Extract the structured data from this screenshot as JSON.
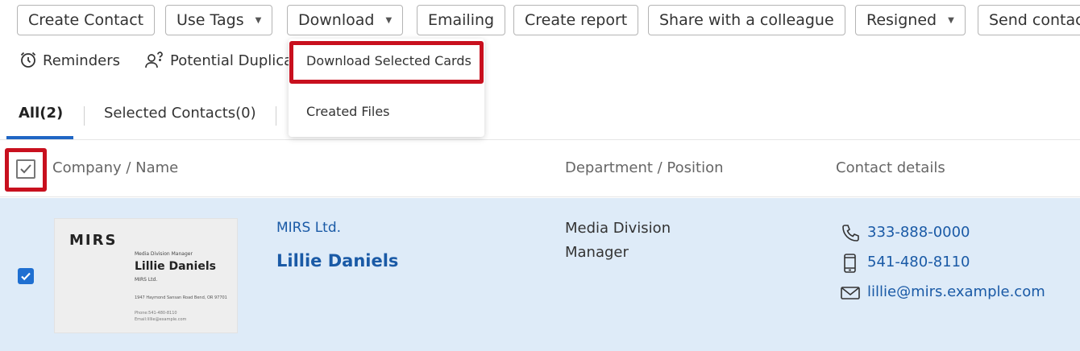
{
  "toolbar": {
    "buttons": [
      {
        "label": "Create Contact",
        "dropdown": false
      },
      {
        "label": "Use Tags",
        "dropdown": true
      },
      {
        "label": "Download",
        "dropdown": true
      },
      {
        "label": "Emailing",
        "dropdown": false
      },
      {
        "label": "Create report",
        "dropdown": false
      },
      {
        "label": "Share with a colleague",
        "dropdown": false
      },
      {
        "label": "Resigned",
        "dropdown": true
      },
      {
        "label": "Send contac",
        "dropdown": false
      }
    ],
    "caret": "▼"
  },
  "row2": {
    "reminders": "Reminders",
    "duplicates": "Potential Duplica"
  },
  "tabs": [
    {
      "label": "All(2)",
      "active": true
    },
    {
      "label": "Selected Contacts(0)",
      "active": false
    }
  ],
  "dropdown": {
    "items": [
      "Download Selected Cards",
      "Created Files"
    ]
  },
  "table": {
    "headers": {
      "company_name": "Company / Name",
      "dept_position": "Department / Position",
      "contact": "Contact details"
    },
    "rows": [
      {
        "checked": true,
        "card": {
          "logo": "MIRS",
          "title": "Media Division Manager",
          "name": "Lillie Daniels",
          "company": "MIRS Ltd.",
          "address": "1947 Haymond Sansan Road Bend, OR 97701",
          "phone": "Phone:541-480-8110",
          "email": "Email:lillie@example.com"
        },
        "company": "MIRS Ltd.",
        "name": "Lillie Daniels",
        "department": "Media Division",
        "position": "Manager",
        "phone": "333-888-0000",
        "mobile": "541-480-8110",
        "email": "lillie@mirs.example.com"
      }
    ]
  },
  "colors": {
    "accent": "#1f66c4",
    "link": "#1a5aa6",
    "highlight": "#c8101e",
    "selected_row": "#deebf8"
  },
  "icons": {
    "alarm": "alarm-clock-icon",
    "duplicate": "person-question-icon",
    "phone": "phone-icon",
    "mobile": "mobile-icon",
    "email": "envelope-icon",
    "check": "checkmark-icon"
  }
}
